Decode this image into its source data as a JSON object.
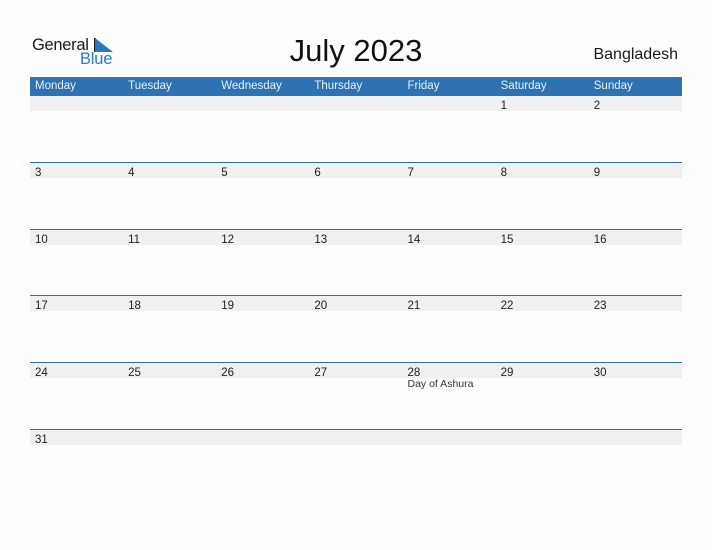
{
  "logo": {
    "general": "General",
    "blue": "Blue"
  },
  "title": "July 2023",
  "country": "Bangladesh",
  "colors": {
    "header": "#2e72b2",
    "band": "#f0f0f0",
    "brand": "#2a7ac0"
  },
  "weekdays": [
    "Monday",
    "Tuesday",
    "Wednesday",
    "Thursday",
    "Friday",
    "Saturday",
    "Sunday"
  ],
  "weeks": [
    [
      {
        "d": ""
      },
      {
        "d": ""
      },
      {
        "d": ""
      },
      {
        "d": ""
      },
      {
        "d": ""
      },
      {
        "d": "1"
      },
      {
        "d": "2"
      }
    ],
    [
      {
        "d": "3"
      },
      {
        "d": "4"
      },
      {
        "d": "5"
      },
      {
        "d": "6"
      },
      {
        "d": "7"
      },
      {
        "d": "8"
      },
      {
        "d": "9"
      }
    ],
    [
      {
        "d": "10"
      },
      {
        "d": "11"
      },
      {
        "d": "12"
      },
      {
        "d": "13"
      },
      {
        "d": "14"
      },
      {
        "d": "15"
      },
      {
        "d": "16"
      }
    ],
    [
      {
        "d": "17"
      },
      {
        "d": "18"
      },
      {
        "d": "19"
      },
      {
        "d": "20"
      },
      {
        "d": "21"
      },
      {
        "d": "22"
      },
      {
        "d": "23"
      }
    ],
    [
      {
        "d": "24"
      },
      {
        "d": "25"
      },
      {
        "d": "26"
      },
      {
        "d": "27"
      },
      {
        "d": "28",
        "holiday": "Day of Ashura"
      },
      {
        "d": "29"
      },
      {
        "d": "30"
      }
    ],
    [
      {
        "d": "31"
      },
      {
        "d": ""
      },
      {
        "d": ""
      },
      {
        "d": ""
      },
      {
        "d": ""
      },
      {
        "d": ""
      },
      {
        "d": ""
      }
    ]
  ]
}
